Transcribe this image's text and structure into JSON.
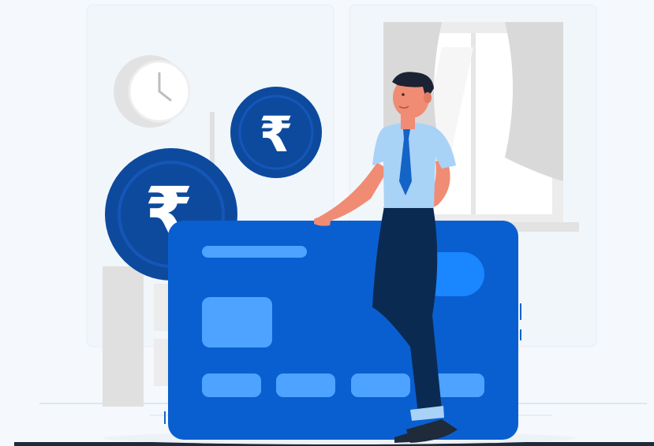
{
  "illustration": {
    "subject": "person-with-payment-card",
    "currency_symbol": "₹",
    "colors": {
      "background": "#f5f9fd",
      "card_blue": "#0a5fd0",
      "card_accent": "#4da3ff",
      "card_bright": "#1a86ff",
      "coin_dark": "#0d4a9e",
      "coin_rim": "#1556b8",
      "shirt": "#a9d2f7",
      "tie": "#1464c8",
      "trousers": "#0b2a52",
      "skin": "#f08c74",
      "hair": "#1a2233",
      "room_grey": "#e3e3e3",
      "room_line": "#c8d4e0"
    }
  }
}
